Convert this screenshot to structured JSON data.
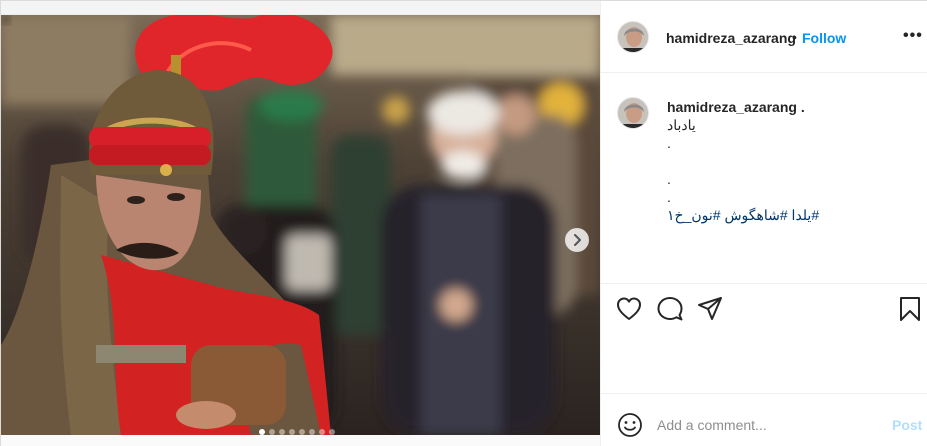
{
  "header": {
    "username": "hamidreza_azarang",
    "bullet": "•",
    "follow_label": "Follow",
    "more_label": "•••"
  },
  "caption": {
    "username": "hamidreza_azarang",
    "username_suffix": " .",
    "lines": [
      "یادباد",
      ".",
      "",
      ".",
      "."
    ],
    "hashtags": "#یلدا #شاهگوش #نون_خ۱"
  },
  "media": {
    "carousel_count": 8,
    "active_index": 0,
    "next_icon": "chevron-right-icon"
  },
  "actions": {
    "like_icon": "heart-icon",
    "comment_icon": "comment-bubble-icon",
    "share_icon": "paper-plane-icon",
    "save_icon": "bookmark-icon"
  },
  "comment": {
    "placeholder": "Add a comment...",
    "value": "",
    "post_label": "Post",
    "emoji_icon": "smiley-icon"
  },
  "colors": {
    "link_blue": "#0095f6",
    "post_disabled": "#b2dffc",
    "hashtag": "#00376b"
  }
}
